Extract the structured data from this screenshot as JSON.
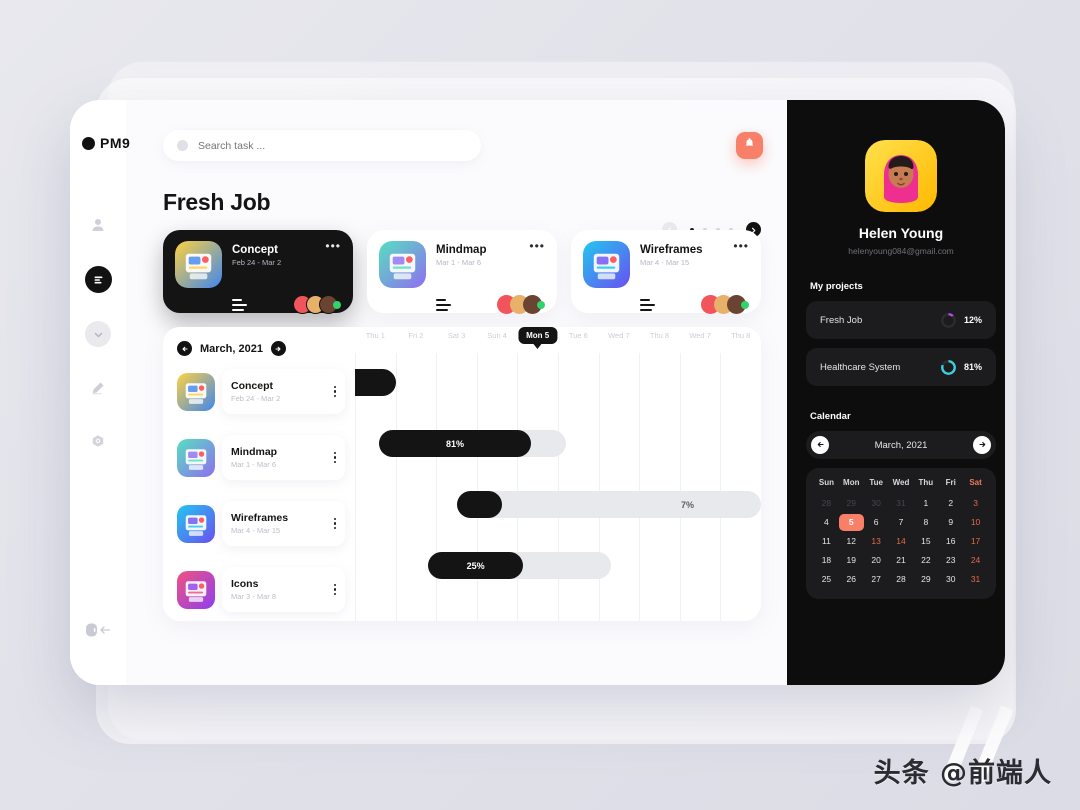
{
  "brand": {
    "name": "PM9"
  },
  "search": {
    "placeholder": "Search task ...",
    "value": ""
  },
  "header": {
    "title": "Fresh Job",
    "bell_icon": "bell-icon"
  },
  "rail": {
    "items": [
      {
        "icon": "user-icon",
        "active": false
      },
      {
        "icon": "list-menu-icon",
        "active": true
      },
      {
        "icon": "chat-icon",
        "active": false
      },
      {
        "icon": "pen-icon",
        "active": false
      },
      {
        "icon": "settings-icon",
        "active": false
      }
    ],
    "logout": {
      "icon": "logout-icon"
    }
  },
  "pager": {
    "prev_icon": "chevron-left-icon",
    "next_icon": "chevron-right-icon",
    "dots": 4,
    "active_dot": 0
  },
  "cards": [
    {
      "name": "Concept",
      "date": "Feb 24 - Mar 2",
      "dark": true,
      "c1": "#ffd23f",
      "c2": "#3f86f0",
      "members": 3,
      "online": true
    },
    {
      "name": "Mindmap",
      "date": "Mar 1 - Mar 6",
      "dark": false,
      "c1": "#56dfc0",
      "c2": "#8f6ef0",
      "members": 3,
      "online": true
    },
    {
      "name": "Wireframes",
      "date": "Mar 4 - Mar 15",
      "dark": false,
      "c1": "#21c7f0",
      "c2": "#6a4ff0",
      "members": 3,
      "online": true
    }
  ],
  "gantt": {
    "month": "March, 2021",
    "prev_icon": "arrow-left-icon",
    "next_icon": "arrow-right-icon",
    "days": [
      "Thu 1",
      "Fri 2",
      "Sat 3",
      "Sun 4",
      "Mon 5",
      "Tue 6",
      "Wed 7",
      "Thu 8",
      "Wed 7",
      "Thu 8"
    ],
    "today_index": 4,
    "tasks": [
      {
        "name": "Concept",
        "date": "Feb 24 - Mar 2",
        "c1": "#ffd23f",
        "c2": "#3f86f0"
      },
      {
        "name": "Mindmap",
        "date": "Mar 1 - Mar 6",
        "c1": "#56dfc0",
        "c2": "#8f6ef0"
      },
      {
        "name": "Wireframes",
        "date": "Mar 4 - Mar 15",
        "c1": "#21c7f0",
        "c2": "#6a4ff0"
      },
      {
        "name": "Icons",
        "date": "Mar 3 - Mar 8",
        "c1": "#f0527f",
        "c2": "#8f3ff0"
      }
    ]
  },
  "chart_data": {
    "type": "bar",
    "title": "March, 2021",
    "categories": [
      "Concept",
      "Mindmap",
      "Wireframes",
      "Icons"
    ],
    "xlabel": "",
    "ylabel": "",
    "axis_ticks": [
      "Thu 1",
      "Fri 2",
      "Sat 3",
      "Sun 4",
      "Mon 5",
      "Tue 6",
      "Wed 7",
      "Thu 8",
      "Wed 7",
      "Thu 8"
    ],
    "grid": true,
    "legend": "none",
    "series": [
      {
        "name": "progress_percent",
        "values": [
          100,
          81,
          7,
          25
        ]
      }
    ],
    "bars": [
      {
        "task": "Concept",
        "track_left_pct": -6,
        "track_width_pct": 16,
        "fill_pct": 100,
        "label": "",
        "label_visible": false
      },
      {
        "task": "Mindmap",
        "track_left_pct": 6,
        "track_width_pct": 46,
        "fill_pct": 81,
        "label": "81%",
        "label_visible": true
      },
      {
        "task": "Wireframes",
        "track_left_pct": 25,
        "track_width_pct": 75,
        "fill_pct": 15,
        "label": "7%",
        "label_visible": true
      },
      {
        "task": "Icons",
        "track_left_pct": 18,
        "track_width_pct": 45,
        "fill_pct": 52,
        "label": "25%",
        "label_visible": true
      }
    ]
  },
  "profile": {
    "name": "Helen Young",
    "email": "helenyoung084@gmail.com",
    "avatar_icon": "user-avatar"
  },
  "projects": {
    "title": "My projects",
    "items": [
      {
        "name": "Fresh Job",
        "percent": "12%",
        "color": "#b44bdd"
      },
      {
        "name": "Healthcare System",
        "percent": "81%",
        "color": "#3ad0e0"
      }
    ]
  },
  "calendar": {
    "title": "Calendar",
    "month": "March, 2021",
    "prev_icon": "arrow-left-icon",
    "next_icon": "arrow-right-icon",
    "weekdays": [
      "Sun",
      "Mon",
      "Tue",
      "Wed",
      "Thu",
      "Fri",
      "Sat"
    ],
    "days": [
      {
        "n": "28",
        "s": "mut"
      },
      {
        "n": "29",
        "s": "mut"
      },
      {
        "n": "30",
        "s": "mut"
      },
      {
        "n": "31",
        "s": "mut"
      },
      {
        "n": "1",
        "s": ""
      },
      {
        "n": "2",
        "s": ""
      },
      {
        "n": "3",
        "s": "red"
      },
      {
        "n": "4",
        "s": ""
      },
      {
        "n": "5",
        "s": "sel"
      },
      {
        "n": "6",
        "s": ""
      },
      {
        "n": "7",
        "s": ""
      },
      {
        "n": "8",
        "s": ""
      },
      {
        "n": "9",
        "s": ""
      },
      {
        "n": "10",
        "s": "red"
      },
      {
        "n": "11",
        "s": ""
      },
      {
        "n": "12",
        "s": ""
      },
      {
        "n": "13",
        "s": "red"
      },
      {
        "n": "14",
        "s": "red"
      },
      {
        "n": "15",
        "s": ""
      },
      {
        "n": "16",
        "s": ""
      },
      {
        "n": "17",
        "s": "red"
      },
      {
        "n": "18",
        "s": ""
      },
      {
        "n": "19",
        "s": ""
      },
      {
        "n": "20",
        "s": ""
      },
      {
        "n": "21",
        "s": ""
      },
      {
        "n": "22",
        "s": ""
      },
      {
        "n": "23",
        "s": ""
      },
      {
        "n": "24",
        "s": "red"
      },
      {
        "n": "25",
        "s": ""
      },
      {
        "n": "26",
        "s": ""
      },
      {
        "n": "27",
        "s": ""
      },
      {
        "n": "28",
        "s": ""
      },
      {
        "n": "29",
        "s": ""
      },
      {
        "n": "30",
        "s": ""
      },
      {
        "n": "31",
        "s": "red"
      }
    ]
  },
  "watermark": {
    "text": "头条 @前端人"
  },
  "colors": {
    "accent": "#f98068",
    "dark": "#141414",
    "panel": "#0d0d0d",
    "track": "#e8e9ed"
  }
}
